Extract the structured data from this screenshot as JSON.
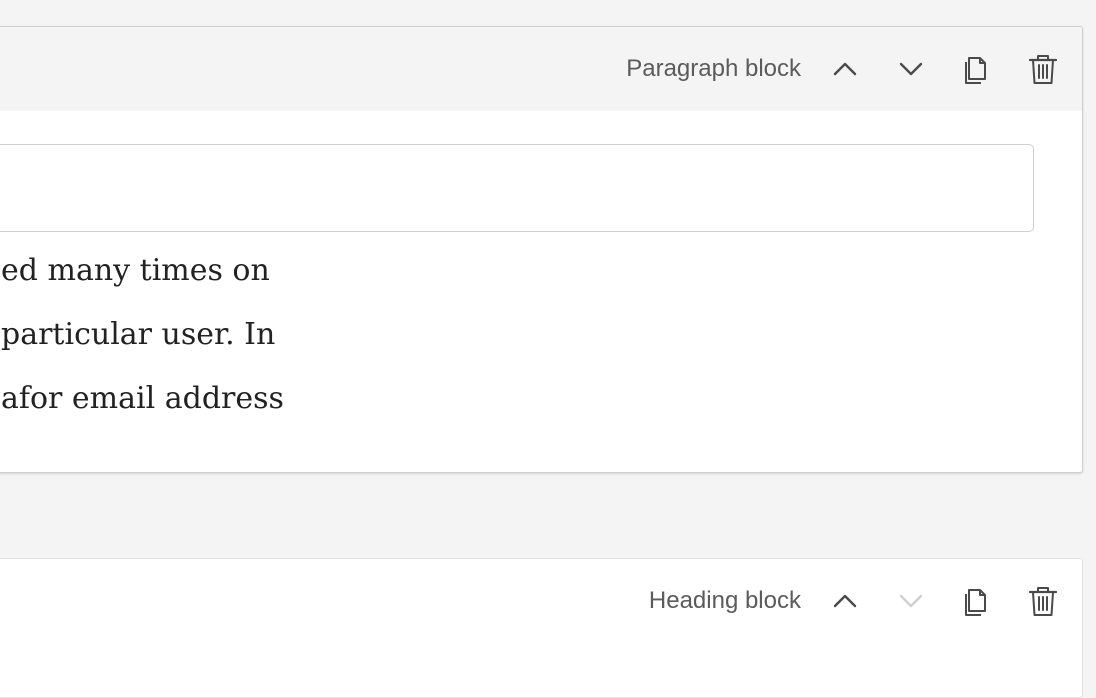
{
  "paragraph_block": {
    "type_label": "Paragraph block",
    "lines": [
      "ed many times on",
      "particular user. In",
      "afor email address"
    ],
    "input_value": ""
  },
  "heading_block": {
    "type_label": "Heading block"
  },
  "icons": {
    "up": "chevron-up-icon",
    "down": "chevron-down-icon",
    "copy": "copy-icon",
    "delete": "trash-icon"
  },
  "colors": {
    "icon": "#5b5b5b",
    "icon_disabled": "#d0d0d0"
  }
}
